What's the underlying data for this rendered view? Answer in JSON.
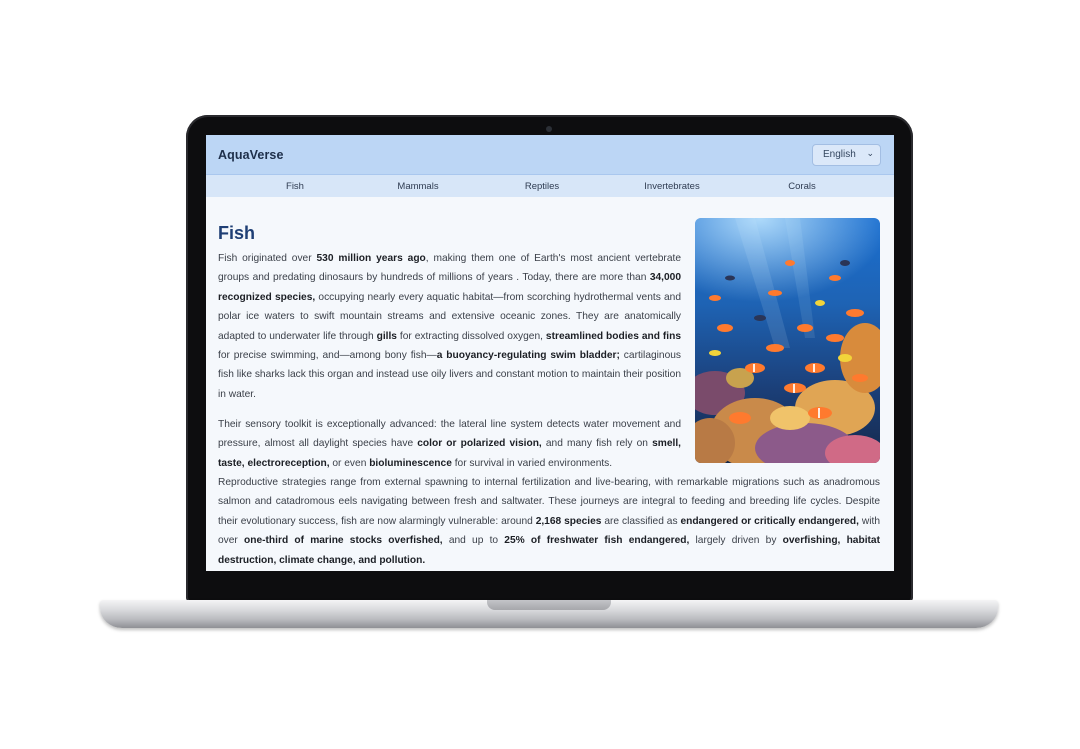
{
  "app": {
    "brand": "AquaVerse",
    "language": "English"
  },
  "nav": {
    "items": [
      "Fish",
      "Mammals",
      "Reptiles",
      "Invertebrates",
      "Corals"
    ]
  },
  "article": {
    "title": "Fish",
    "p1": [
      {
        "t": "Fish originated over ",
        "b": false
      },
      {
        "t": "530 million years ago",
        "b": true
      },
      {
        "t": ", making them one of Earth's most ancient vertebrate groups and predating dinosaurs by hundreds of millions of years . Today, there are more than ",
        "b": false
      },
      {
        "t": "34,000 recognized species,",
        "b": true
      },
      {
        "t": " occupying nearly every aquatic habitat—from scorching hydrothermal vents and polar ice waters to swift mountain streams and extensive oceanic zones. They are anatomically adapted to underwater life through ",
        "b": false
      },
      {
        "t": "gills",
        "b": true
      },
      {
        "t": " for extracting dissolved oxygen, ",
        "b": false
      },
      {
        "t": "streamlined bodies and fins",
        "b": true
      },
      {
        "t": " for precise swimming, and—among bony fish—",
        "b": false
      },
      {
        "t": "a buoyancy-regulating swim bladder;",
        "b": true
      },
      {
        "t": " cartilaginous fish like sharks lack this organ and instead use oily livers and constant motion to maintain their position in water.",
        "b": false
      }
    ],
    "p2a": [
      {
        "t": "Their sensory toolkit is exceptionally advanced: the lateral line system detects water movement and pressure, almost all daylight species have ",
        "b": false
      },
      {
        "t": "color or polarized vision,",
        "b": true
      },
      {
        "t": " and many fish rely on ",
        "b": false
      },
      {
        "t": "smell, taste, electroreception,",
        "b": true
      },
      {
        "t": " or even ",
        "b": false
      },
      {
        "t": "bioluminescence",
        "b": true
      },
      {
        "t": " for survival in varied environments.",
        "b": false
      }
    ],
    "p2b": [
      {
        "t": "Reproductive strategies range from external spawning to internal fertilization and live-bearing, with remarkable migrations such as anadromous salmon and catadromous eels navigating between fresh and saltwater. These journeys are integral to feeding and breeding life cycles. Despite their evolutionary success, fish are now alarmingly vulnerable: around ",
        "b": false
      },
      {
        "t": "2,168 species",
        "b": true
      },
      {
        "t": " are classified as ",
        "b": false
      },
      {
        "t": "endangered or critically endangered,",
        "b": true
      },
      {
        "t": " with over ",
        "b": false
      },
      {
        "t": "one-third of marine stocks overfished,",
        "b": true
      },
      {
        "t": " and up to ",
        "b": false
      },
      {
        "t": "25% of freshwater fish endangered,",
        "b": true
      },
      {
        "t": " largely driven by ",
        "b": false
      },
      {
        "t": "overfishing, habitat destruction, climate change, and pollution.",
        "b": true
      }
    ]
  },
  "colors": {
    "topbar": "#bcd6f5",
    "navbar": "#d7e6f8",
    "title": "#1f3f75",
    "screen_bg": "#f5f8fc"
  }
}
